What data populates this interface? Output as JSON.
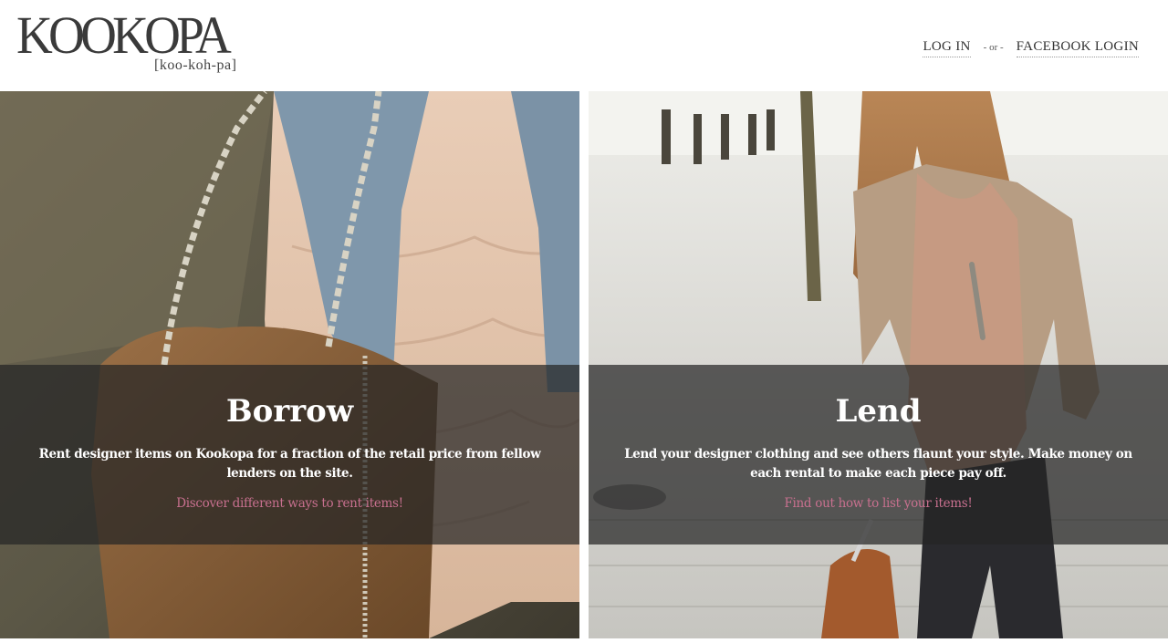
{
  "brand": {
    "name": "KOOKOPA",
    "pronunciation": "[koo-koh-pa]"
  },
  "auth": {
    "login_label": "LOG IN",
    "separator": "- or -",
    "facebook_label": "FACEBOOK LOGIN"
  },
  "colors": {
    "link_pink": "#c8708f",
    "overlay": "#262626",
    "text_dark": "#333333"
  },
  "panels": [
    {
      "title": "Borrow",
      "description": "Rent designer items on Kookopa for a fraction of the retail price from fellow lenders on the site.",
      "link": "Discover different ways to rent items!",
      "image_icon": "handbag-photo"
    },
    {
      "title": "Lend",
      "description": "Lend your designer clothing and see others flaunt your style. Make money on each rental to make each piece pay off.",
      "link": "Find out how to list your items!",
      "image_icon": "street-style-photo"
    }
  ]
}
